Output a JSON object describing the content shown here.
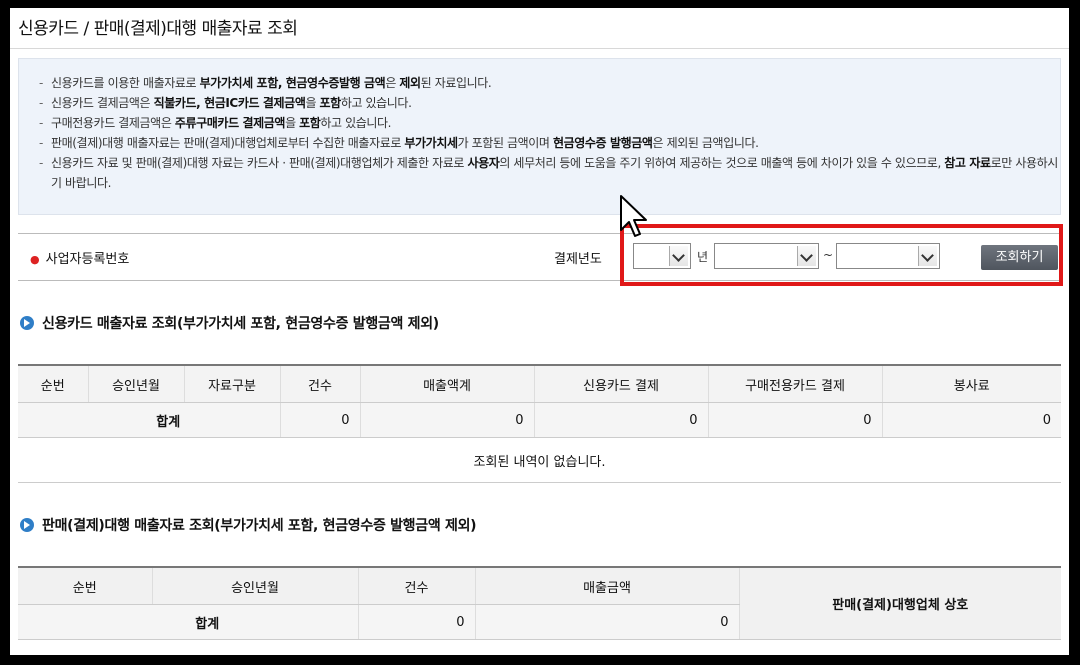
{
  "page_title": "신용카드 / 판매(결제)대행 매출자료 조회",
  "notice": [
    {
      "pre": "신용카드를 이용한 매출자료로 ",
      "b1": "부가가치세 포함, 현금영수증발행 금액",
      "mid": "은 ",
      "b2": "제외",
      "post": "된 자료입니다."
    },
    {
      "pre": "신용카드 결제금액은 ",
      "b1": "직불카드, 현금IC카드 결제금액",
      "mid": "을 ",
      "b2": "포함",
      "post": "하고 있습니다."
    },
    {
      "pre": "구매전용카드 결제금액은 ",
      "b1": "주류구매카드 결제금액",
      "mid": "을 ",
      "b2": "포함",
      "post": "하고 있습니다."
    },
    {
      "pre": "판매(결제)대행 매출자료는 판매(결제)대행업체로부터 수집한 매출자료로 ",
      "b1": "부가가치세",
      "mid": "가 포함된 금액이며 ",
      "b2": "현금영수증 발행금액",
      "post": "은 제외된 금액입니다."
    },
    {
      "pre": "신용카드 자료 및 판매(결제)대행 자료는 카드사 · 판매(결제)대행업체가 제출한 자료로 ",
      "b1": "사용자",
      "mid": "의 세무처리 등에 도움을 주기 위하여 제공하는 것으로 매출액 등에 차이가 있을 수 있으므로, ",
      "b2": "참고 자료",
      "post": "로만 사용하시기 바랍니다."
    }
  ],
  "search": {
    "business_no_label": "사업자등록번호",
    "year_label": "결제년도",
    "year_unit": "년",
    "range_sep": "~",
    "year_value": "",
    "from_value": "",
    "to_value": "",
    "submit_label": "조회하기"
  },
  "section1": {
    "title": "신용카드 매출자료 조회(부가가치세 포함, 현금영수증 발행금액 제외)",
    "columns": [
      "순번",
      "승인년월",
      "자료구분",
      "건수",
      "매출액계",
      "신용카드 결제",
      "구매전용카드 결제",
      "봉사료"
    ],
    "sum_label": "합계",
    "sum_values": [
      "0",
      "0",
      "0",
      "0",
      "0"
    ],
    "empty_text": "조회된 내역이 없습니다."
  },
  "section2": {
    "title": "판매(결제)대행 매출자료 조회(부가가치세 포함, 현금영수증 발행금액 제외)",
    "columns": [
      "순번",
      "승인년월",
      "건수",
      "매출금액",
      "판매(결제)대행업체 상호"
    ],
    "sum_label": "합계",
    "sum_values": [
      "0",
      "0"
    ]
  },
  "colors": {
    "highlight_box": "#e01818",
    "button_bg": "#5a606a",
    "bullet": "#2f7ec7",
    "required_star": "#d22222"
  }
}
